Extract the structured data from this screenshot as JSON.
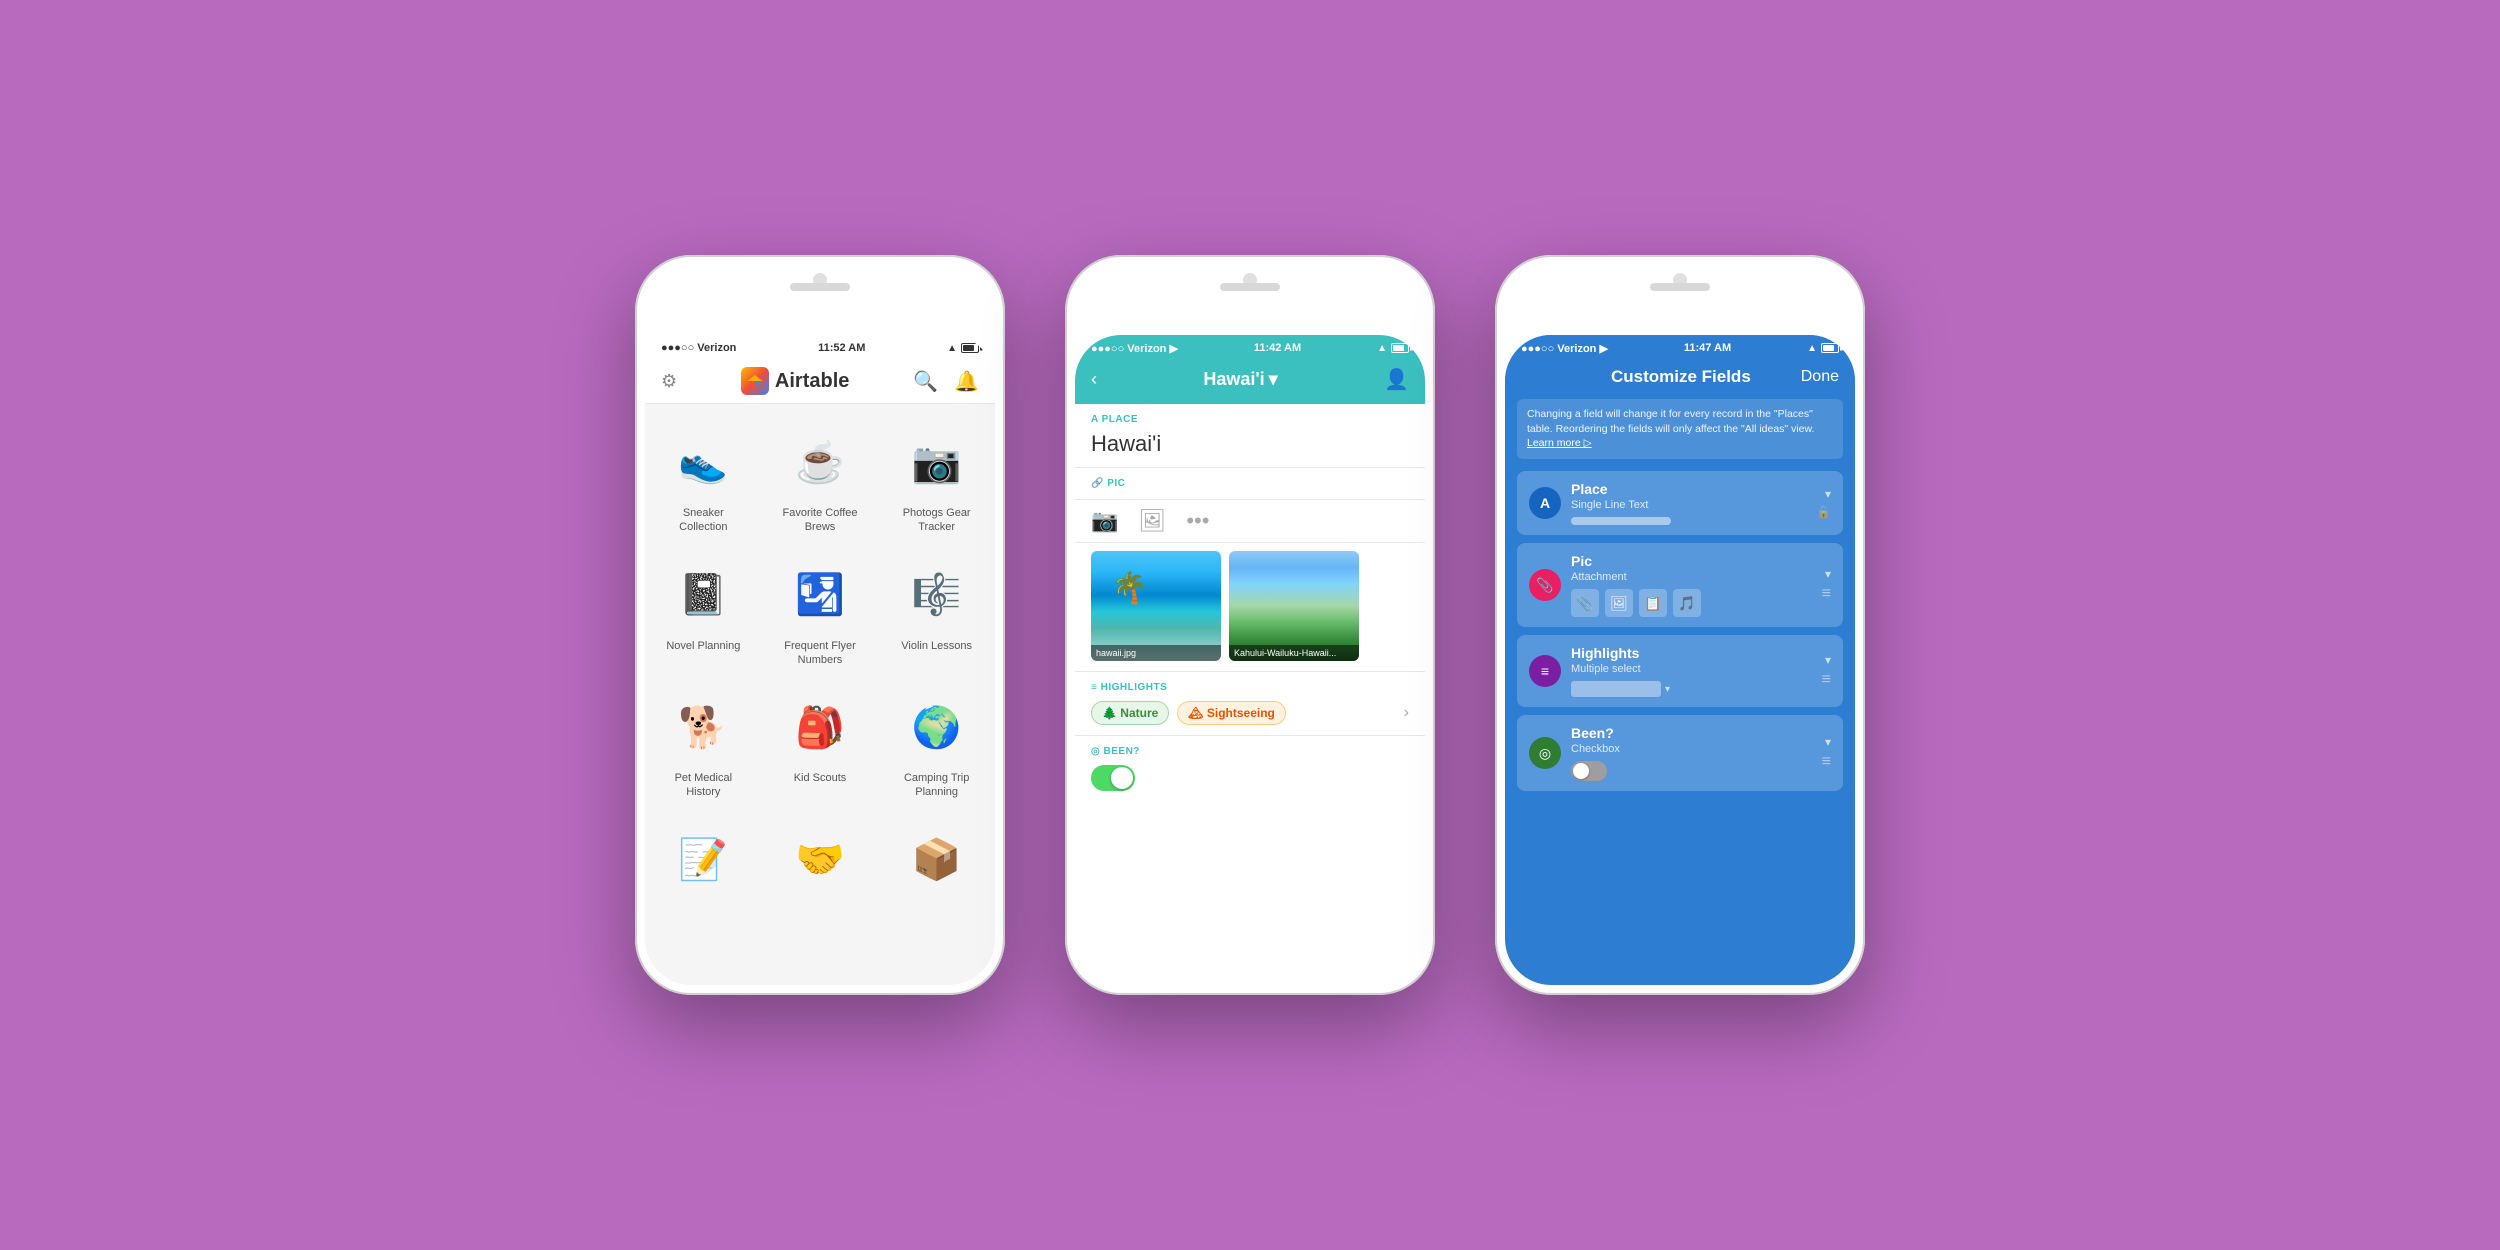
{
  "background": "#b86abf",
  "phones": {
    "phone1": {
      "status": {
        "carrier": "●●●○○ Verizon",
        "time": "11:52 AM",
        "signal": "▲",
        "battery": "■■■"
      },
      "header": {
        "settings_icon": "⚙",
        "logo_text": "Airtable",
        "search_icon": "🔍",
        "bell_icon": "🔔"
      },
      "apps": [
        {
          "icon": "👟",
          "label": "Sneaker\nCollection"
        },
        {
          "icon": "☕",
          "label": "Favorite Coffee\nBrews"
        },
        {
          "icon": "📷",
          "label": "Photogs Gear\nTracker"
        },
        {
          "icon": "📓",
          "label": "Novel Planning"
        },
        {
          "icon": "🛂",
          "label": "Frequent Flyer\nNumbers"
        },
        {
          "icon": "🎼",
          "label": "Violin Lessons"
        },
        {
          "icon": "🐕",
          "label": "Pet Medical\nHistory"
        },
        {
          "icon": "🎒",
          "label": "Kid Scouts"
        },
        {
          "icon": "🌍",
          "label": "Camping Trip\nPlanning"
        },
        {
          "icon": "📝",
          "label": ""
        },
        {
          "icon": "🤝",
          "label": ""
        },
        {
          "icon": "📦",
          "label": ""
        }
      ]
    },
    "phone2": {
      "status": {
        "carrier": "●●●○○ Verizon",
        "time": "11:42 AM",
        "battery": "■■■"
      },
      "header": {
        "back": "‹",
        "title": "Hawai'i",
        "dropdown": "▾",
        "person": "👤"
      },
      "fields": {
        "place_label": "A PLACE",
        "place_value": "Hawai'i",
        "pic_label": "🔗 PIC",
        "photo1_name": "hawaii.jpg",
        "photo2_name": "Kahului-Wailuku-Hawaii...",
        "highlights_label": "≡ HIGHLIGHTS",
        "nature_tag": "🌲 Nature",
        "sightseeing_tag": "🏔 Sightseeing",
        "been_label": "◎ BEEN?"
      }
    },
    "phone3": {
      "status": {
        "carrier": "●●●○○ Verizon",
        "time": "11:47 AM",
        "battery": "■■■"
      },
      "header": {
        "title": "Customize Fields",
        "done": "Done"
      },
      "info_text": "Changing a field will change it for every record in the \"Places\" table. Reordering the fields will only affect the \"All ideas\" view.",
      "learn_more": "Learn more ▷",
      "fields": [
        {
          "name": "Place",
          "type": "Single Line Text",
          "icon": "A",
          "icon_bg": "blue",
          "has_bar": true,
          "has_lock": true
        },
        {
          "name": "Pic",
          "type": "Attachment",
          "icon": "📎",
          "icon_bg": "pink",
          "has_actions": true,
          "actions": [
            "📎",
            "🖼",
            "📋",
            "🎵"
          ]
        },
        {
          "name": "Highlights",
          "type": "Multiple select",
          "icon": "≡",
          "icon_bg": "purple",
          "has_dropdown": true
        },
        {
          "name": "Been?",
          "type": "Checkbox",
          "icon": "◎",
          "icon_bg": "green",
          "has_toggle": true
        }
      ]
    }
  }
}
